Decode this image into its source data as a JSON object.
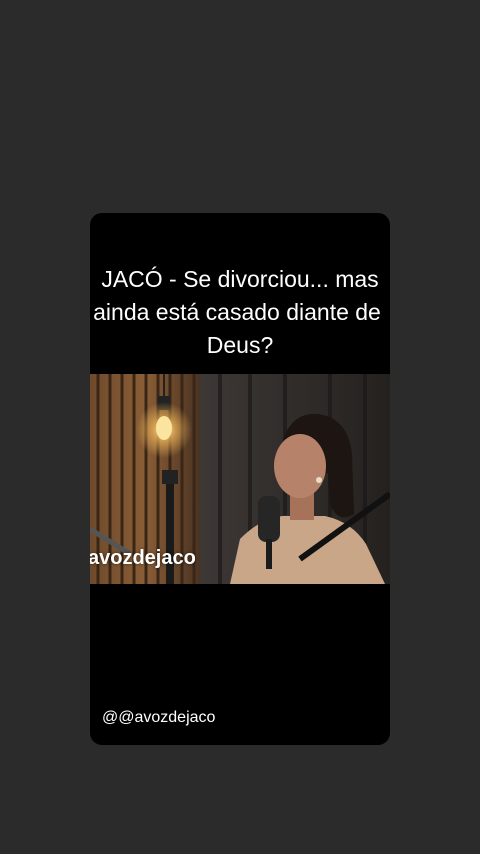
{
  "post": {
    "title_line1": "JACÓ - Se divorciou... mas",
    "title_line2": "ainda está casado diante de",
    "title_line3": "Deus?",
    "video_watermark": "avozdejaco",
    "handle": "@@avozdejaco"
  },
  "colors": {
    "background": "#2b2b2b",
    "card": "#000000",
    "text": "#ffffff"
  }
}
